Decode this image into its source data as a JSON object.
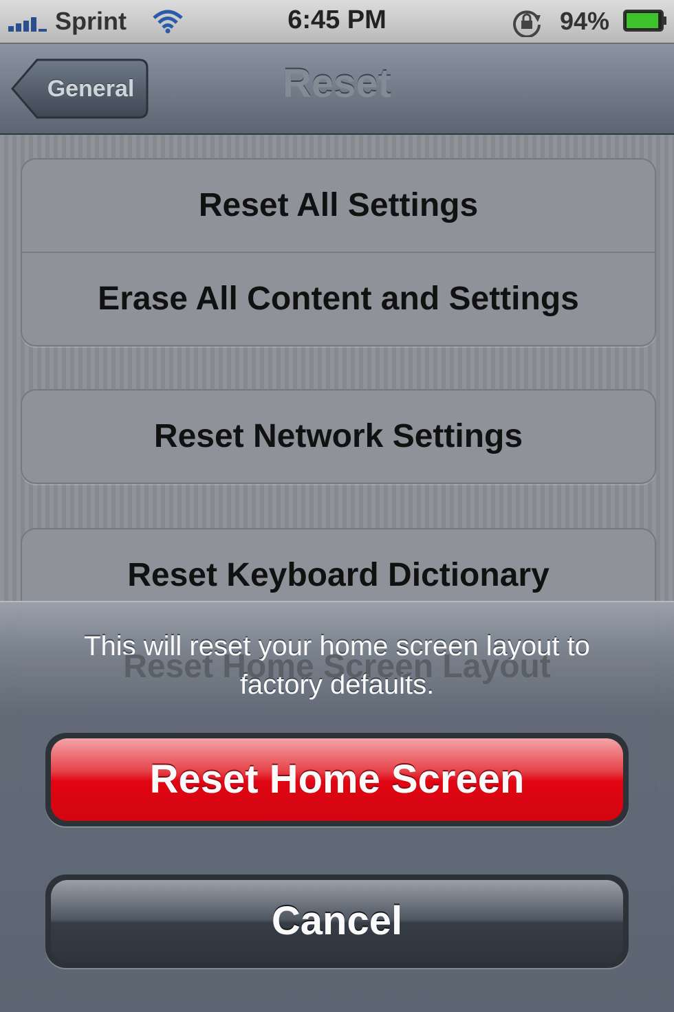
{
  "status_bar": {
    "carrier": "Sprint",
    "time": "6:45 PM",
    "battery_percent": "94%",
    "signal_icon": "signal-bars-icon",
    "wifi_icon": "wifi-icon",
    "rotation_lock_icon": "rotation-lock-icon",
    "battery_icon": "battery-icon",
    "battery_level": 0.94
  },
  "nav": {
    "back_label": "General",
    "title": "Reset"
  },
  "groups": [
    {
      "items": [
        {
          "label": "Reset All Settings"
        },
        {
          "label": "Erase All Content and Settings"
        }
      ]
    },
    {
      "items": [
        {
          "label": "Reset Network Settings"
        }
      ]
    },
    {
      "items": [
        {
          "label": "Reset Keyboard Dictionary"
        },
        {
          "label": "Reset Home Screen Layout"
        }
      ]
    }
  ],
  "action_sheet": {
    "message": "This will reset your home screen layout to factory defaults.",
    "confirm_label": "Reset Home Screen",
    "cancel_label": "Cancel"
  },
  "colors": {
    "destructive": "#e5000e",
    "nav_bar": "#5c6572",
    "cancel": "#333a43"
  }
}
